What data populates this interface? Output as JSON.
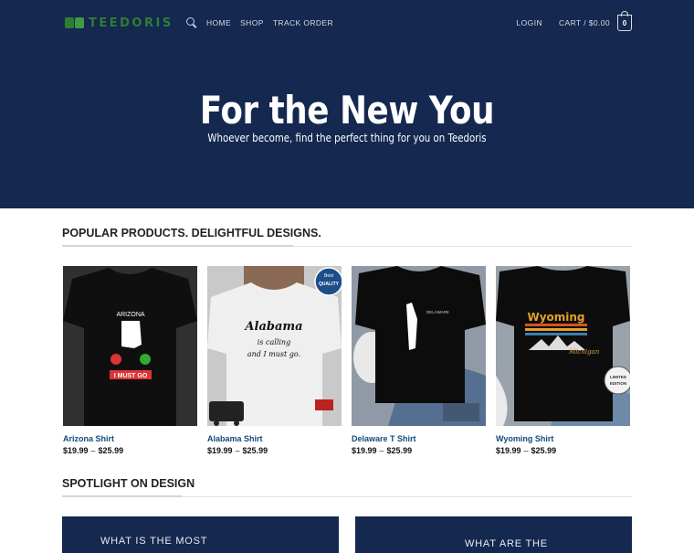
{
  "header": {
    "logo_text": "TEEDORIS",
    "nav": [
      "HOME",
      "SHOP",
      "TRACK ORDER"
    ],
    "login": "LOGIN",
    "cart_label": "CART / $0.00",
    "cart_count": "0"
  },
  "hero": {
    "title": "For the New You",
    "subtitle": "Whoever become, find the perfect thing for you on Teedoris"
  },
  "popular": {
    "heading": "POPULAR PRODUCTS. DELIGHTFUL DESIGNS.",
    "products": [
      {
        "name": "Arizona Shirt",
        "price_low": "$19.99",
        "sep": "–",
        "price_high": "$25.99"
      },
      {
        "name": "Alabama Shirt",
        "price_low": "$19.99",
        "sep": "–",
        "price_high": "$25.99"
      },
      {
        "name": "Delaware T Shirt",
        "price_low": "$19.99",
        "sep": "–",
        "price_high": "$25.99"
      },
      {
        "name": "Wyoming Shirt",
        "price_low": "$19.99",
        "sep": "–",
        "price_high": "$25.99"
      }
    ],
    "shirt_prints": {
      "arizona_state": "ARIZONA",
      "arizona_tag": "I MUST GO",
      "alabama_1": "Alabama",
      "alabama_2": "is calling",
      "alabama_3": "and I must go.",
      "alabama_badge_1": "Best",
      "alabama_badge_2": "QUALITY",
      "delaware": "DELAWARE",
      "wyoming": "Wyoming",
      "wyoming_script": "Michigan",
      "wyoming_badge_1": "LIMITED",
      "wyoming_badge_2": "EDITION"
    }
  },
  "spotlight": {
    "heading": "SPOTLIGHT ON DESIGN",
    "card_left": "WHAT IS THE MOST",
    "card_right": "WHAT ARE THE"
  },
  "colors": {
    "navy": "#142850",
    "logo_green": "#2f7d32",
    "link_blue": "#154a7d"
  }
}
